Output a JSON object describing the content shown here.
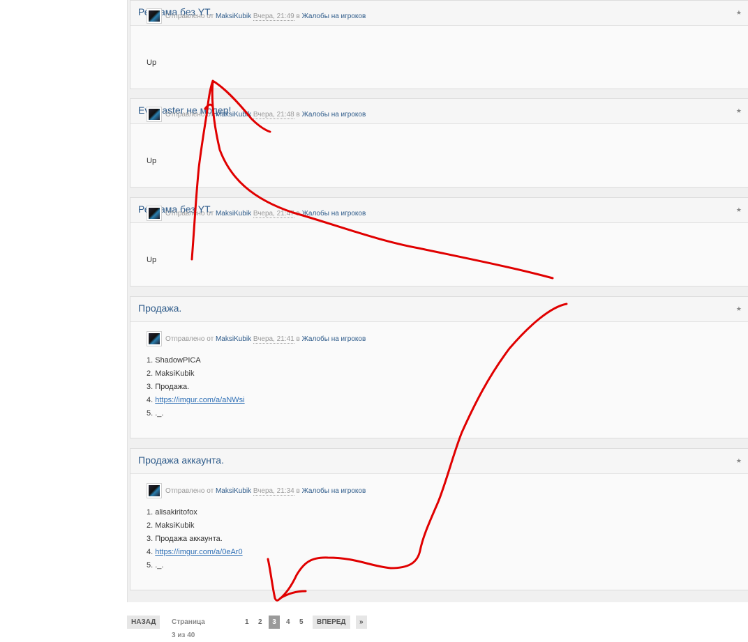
{
  "posts": [
    {
      "title": "Реклама без YT.",
      "prefix": "Отправлено от",
      "author": "MaksiKubik",
      "date": "Вчера, 21:49",
      "in": "в",
      "forum": "Жалобы на игроков",
      "body": [
        "Up"
      ]
    },
    {
      "title": "EvilMaster не модер!",
      "prefix": "Отправлено от",
      "author": "MaksiKubik",
      "date": "Вчера, 21:48",
      "in": "в",
      "forum": "Жалобы на игроков",
      "body": [
        "Up"
      ]
    },
    {
      "title": "Реклама без YT.",
      "prefix": "Отправлено от",
      "author": "MaksiKubik",
      "date": "Вчера, 21:47",
      "in": "в",
      "forum": "Жалобы на игроков",
      "body": [
        "Up"
      ]
    },
    {
      "title": "Продажа.",
      "prefix": "Отправлено от",
      "author": "MaksiKubik",
      "date": "Вчера, 21:41",
      "in": "в",
      "forum": "Жалобы на игроков",
      "body": [
        "1. ShadowPICA",
        "2. MaksiKubik",
        "3. Продажа."
      ],
      "link_num": "4.",
      "link": "https://imgur.com/a/aNWsi",
      "last": "5. ._."
    },
    {
      "title": "Продажа аккаунта.",
      "prefix": "Отправлено от",
      "author": "MaksiKubik",
      "date": "Вчера, 21:34",
      "in": "в",
      "forum": "Жалобы на игроков",
      "body": [
        "1. alisakiritofox",
        "2. MaksiKubik",
        "3. Продажа аккаунта."
      ],
      "link_num": "4.",
      "link": "https://imgur.com/a/0eAr0",
      "last": "5. ._."
    }
  ],
  "post_corner_icon": "star-icon",
  "pagination": {
    "prev": "НАЗАД",
    "info": "Страница 3 из 40",
    "pages": [
      "1",
      "2",
      "3",
      "4",
      "5"
    ],
    "current": "3",
    "next": "ВПЕРЕД",
    "last": "»"
  },
  "colors": {
    "link": "#2e5b8a",
    "annotation": "#e00000"
  }
}
